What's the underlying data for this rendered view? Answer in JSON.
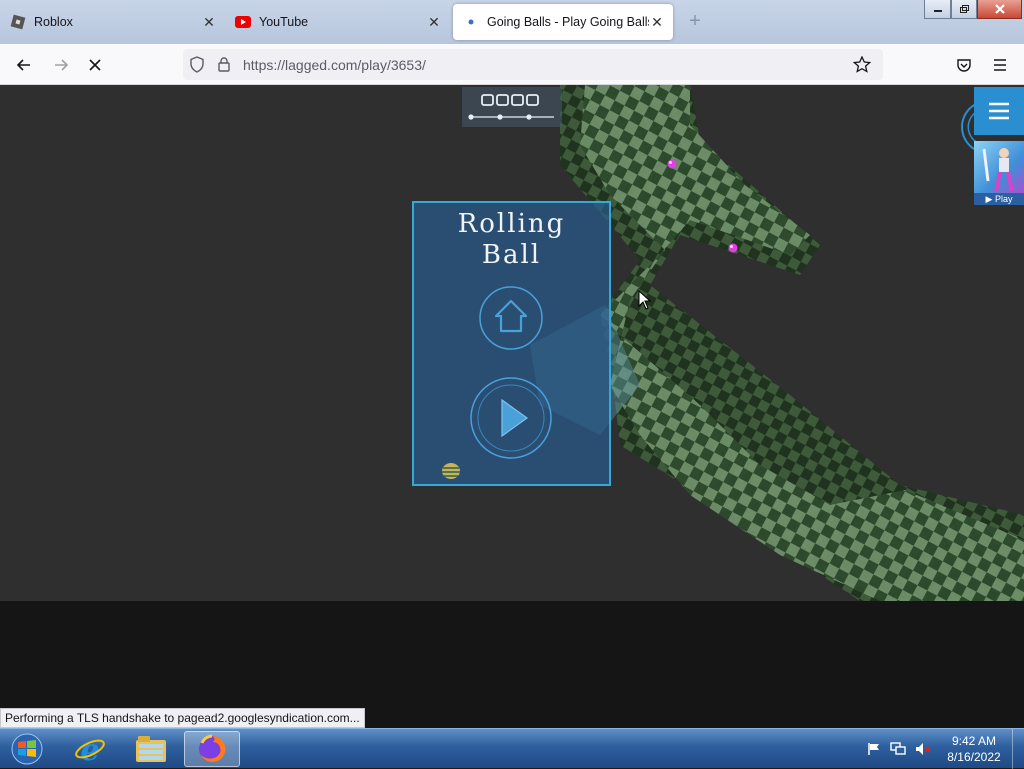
{
  "browser": {
    "tabs": [
      {
        "title": "Roblox",
        "active": false,
        "icon": "roblox-icon"
      },
      {
        "title": "YouTube",
        "active": false,
        "icon": "youtube-icon"
      },
      {
        "title": "Going Balls - Play Going Balls G",
        "active": true,
        "icon": "loading-dot-icon"
      }
    ],
    "url": "https://lagged.com/play/3653/",
    "status_text": "Performing a TLS handshake to pagead2.googlesyndication.com..."
  },
  "game": {
    "menu_title_line1": "Rolling",
    "menu_title_line2": "Ball",
    "buttons": {
      "home": "home-icon",
      "play": "play-icon"
    },
    "ad_label": "▶ Play",
    "colors": {
      "panel": "#2f6a9e",
      "accent": "#36a9d8",
      "track_light": "#6f8f6a",
      "track_dark": "#2d4a2c",
      "gem": "#e040e0"
    }
  },
  "taskbar": {
    "time": "9:42 AM",
    "date": "8/16/2022",
    "apps": [
      "start-orb",
      "internet-explorer-icon",
      "file-explorer-icon",
      "firefox-icon"
    ]
  }
}
